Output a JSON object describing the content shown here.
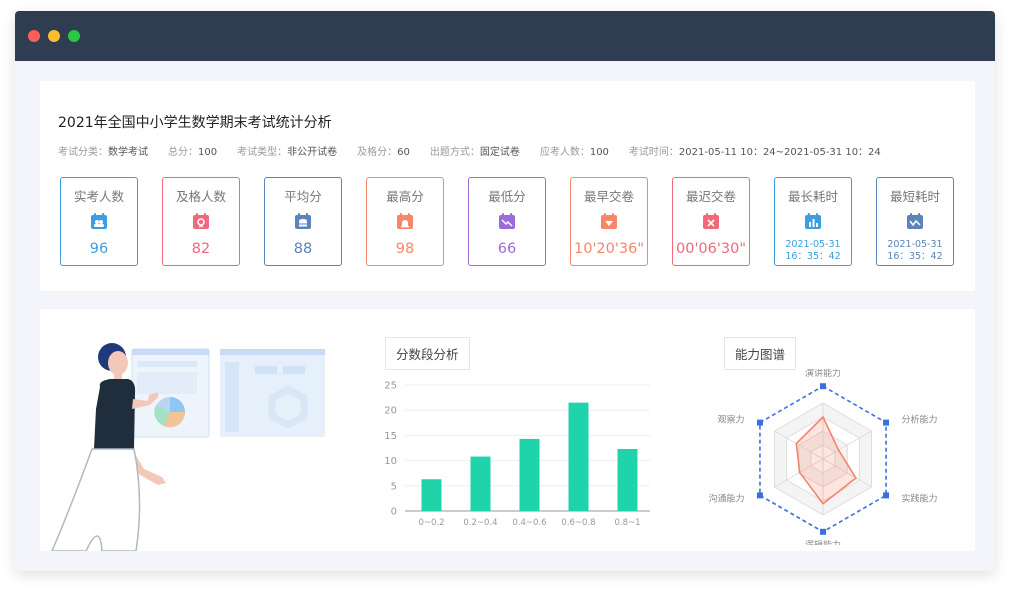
{
  "window": {
    "controls": {
      "close": "#ff5f57",
      "minimize": "#febc2e",
      "maximize": "#28c840"
    }
  },
  "exam": {
    "title": "2021年全国中小学生数学期末考试统计分析",
    "meta": [
      {
        "key": "考试分类：",
        "value": "数学考试"
      },
      {
        "key": "总分：",
        "value": "100"
      },
      {
        "key": "考试类型：",
        "value": "非公开试卷"
      },
      {
        "key": "及格分：",
        "value": "60"
      },
      {
        "key": "出题方式：",
        "value": "固定试卷"
      },
      {
        "key": "应考人数：",
        "value": "100"
      },
      {
        "key": "考试时间：",
        "value": "2021-05-11  10：24~2021-05-31  10：24"
      }
    ]
  },
  "stats": [
    {
      "label": "实考人数",
      "value": "96",
      "color": "#3a9ee0",
      "icon": "people-icon"
    },
    {
      "label": "及格人数",
      "value": "82",
      "color": "#f0687a",
      "icon": "medal-icon"
    },
    {
      "label": "平均分",
      "value": "88",
      "color": "#5b84b8",
      "icon": "coins-icon"
    },
    {
      "label": "最高分",
      "value": "98",
      "color": "#f7866a",
      "icon": "bell-icon"
    },
    {
      "label": "最低分",
      "value": "66",
      "color": "#9b6cd8",
      "icon": "trend-down-icon"
    },
    {
      "label": "最早交卷",
      "value": "10'20'36\"",
      "color": "#f7866a",
      "icon": "arrow-down-icon"
    },
    {
      "label": "最迟交卷",
      "value": "00'06'30\"",
      "color": "#f0687a",
      "icon": "x-icon"
    },
    {
      "label": "最长耗时",
      "value_line1": "2021-05-31",
      "value_line2": "16：35：42",
      "color": "#3a9ee0",
      "icon": "bar-chart-icon"
    },
    {
      "label": "最短耗时",
      "value_line1": "2021-05-31",
      "value_line2": "16：35：42",
      "color": "#5b84b8",
      "icon": "wave-icon"
    }
  ],
  "score_panel": {
    "tab_label": "分数段分析"
  },
  "ability_panel": {
    "tab_label": "能力图谱"
  },
  "chart_data": [
    {
      "type": "bar",
      "title": "分数段分析",
      "categories": [
        "0~0.2",
        "0.2~0.4",
        "0.4~0.6",
        "0.6~0.8",
        "0.8~1"
      ],
      "values": [
        6.3,
        10.8,
        14.3,
        21.5,
        12.3
      ],
      "ylim": [
        0,
        25
      ],
      "yticks": [
        0,
        5,
        10,
        15,
        20,
        25
      ],
      "grid": true,
      "bar_color": "#1fd4aa"
    },
    {
      "type": "radar",
      "title": "能力图谱",
      "axes": [
        "演讲能力",
        "分析能力",
        "实践能力",
        "逻辑能力",
        "沟通能力",
        "观察力"
      ],
      "max": 100,
      "series": [
        {
          "values": [
            100,
            100,
            100,
            100,
            100,
            100
          ],
          "color": "#3b6fe0",
          "style": "dashed"
        },
        {
          "values": [
            75,
            32,
            68,
            80,
            48,
            55
          ],
          "color": "#f4846a",
          "style": "filled"
        }
      ]
    }
  ]
}
